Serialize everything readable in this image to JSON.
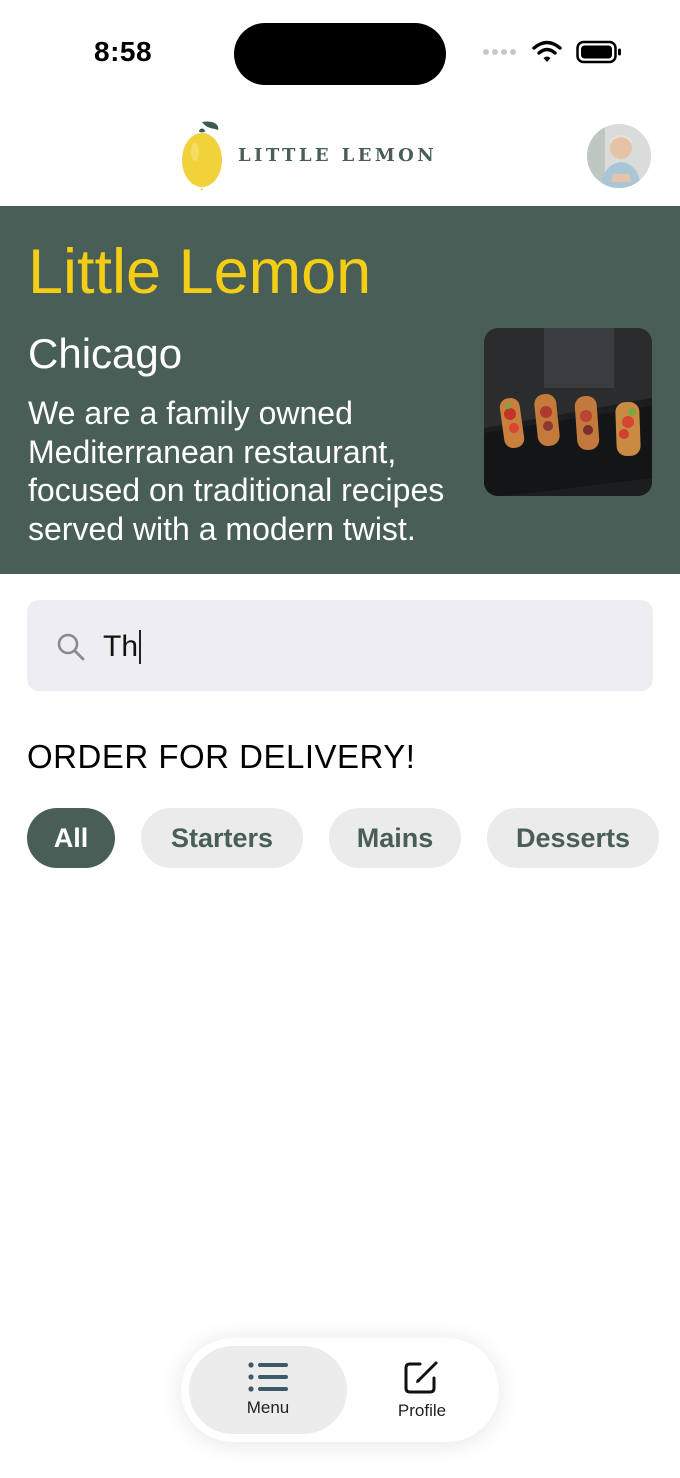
{
  "status_bar": {
    "time": "8:58"
  },
  "header": {
    "logo_text": "LITTLE LEMON"
  },
  "hero": {
    "title": "Little Lemon",
    "city": "Chicago",
    "description": "We are a family owned Mediterranean restaurant, focused on traditional recipes served with a modern twist."
  },
  "search": {
    "value": "Th",
    "icon": "magnifying-glass-icon"
  },
  "order": {
    "title": "ORDER FOR DELIVERY!",
    "categories": [
      {
        "label": "All",
        "selected": true
      },
      {
        "label": "Starters",
        "selected": false
      },
      {
        "label": "Mains",
        "selected": false
      },
      {
        "label": "Desserts",
        "selected": false
      }
    ]
  },
  "tab_bar": {
    "items": [
      {
        "label": "Menu",
        "icon": "list-icon",
        "selected": true
      },
      {
        "label": "Profile",
        "icon": "edit-square-icon",
        "selected": false
      }
    ]
  },
  "colors": {
    "primary": "#495e57",
    "accent": "#f4ce14",
    "chip_bg": "#ebebeb",
    "search_bg": "#eeeef2"
  }
}
